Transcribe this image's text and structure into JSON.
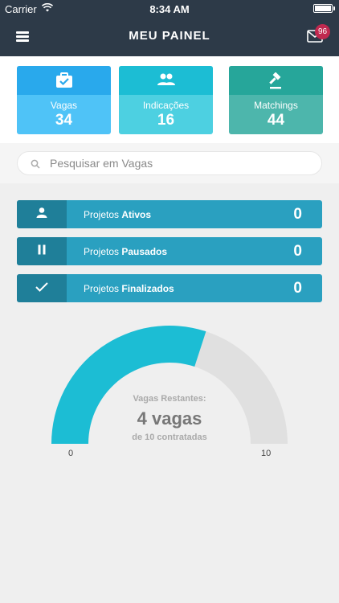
{
  "status_bar": {
    "carrier": "Carrier",
    "time": "8:34 AM"
  },
  "header": {
    "title": "MEU PAINEL",
    "badge_count": "96"
  },
  "stats": [
    {
      "label": "Vagas",
      "value": "34",
      "icon": "briefcase-icon"
    },
    {
      "label": "Indicações",
      "value": "16",
      "icon": "people-icon"
    },
    {
      "label": "Matchings",
      "value": "44",
      "icon": "gavel-icon"
    }
  ],
  "search": {
    "placeholder": "Pesquisar em Vagas"
  },
  "projects": [
    {
      "prefix": "Projetos",
      "status": "Ativos",
      "count": "0",
      "icon": "person-icon"
    },
    {
      "prefix": "Projetos",
      "status": "Pausados",
      "count": "0",
      "icon": "pause-icon"
    },
    {
      "prefix": "Projetos",
      "status": "Finalizados",
      "count": "0",
      "icon": "check-icon"
    }
  ],
  "gauge": {
    "label": "Vagas Restantes:",
    "value_text": "4 vagas",
    "subtext": "de 10 contratadas",
    "min": "0",
    "max": "10",
    "fraction_filled": 0.6
  },
  "colors": {
    "header_bg": "#2d3a48",
    "gauge_fill": "#1cbdd4",
    "gauge_track": "#e0e0e0",
    "badge": "#c0294f"
  }
}
